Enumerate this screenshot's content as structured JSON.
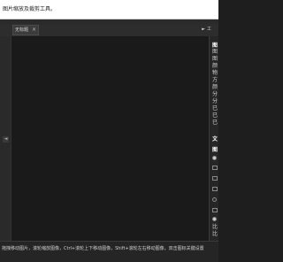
{
  "top_bar": {
    "text": "图片缩放及裁剪工具。"
  },
  "tabs": [
    {
      "label": "无标题",
      "close": "×"
    }
  ],
  "right_panel": {
    "toggle_label": "工",
    "headings": [
      "图",
      "文",
      "图"
    ],
    "lines": [
      "图",
      "图",
      "颜",
      "物",
      "方",
      "颜",
      "分",
      "分",
      "已",
      "已",
      "已",
      "比",
      "比"
    ]
  },
  "status_bar": {
    "text": "拖拽移动图片，滚轮缩放图像，Ctrl+滚轮上下移动图像，Shift+滚轮左右移动图像，双击图标关键设置"
  }
}
